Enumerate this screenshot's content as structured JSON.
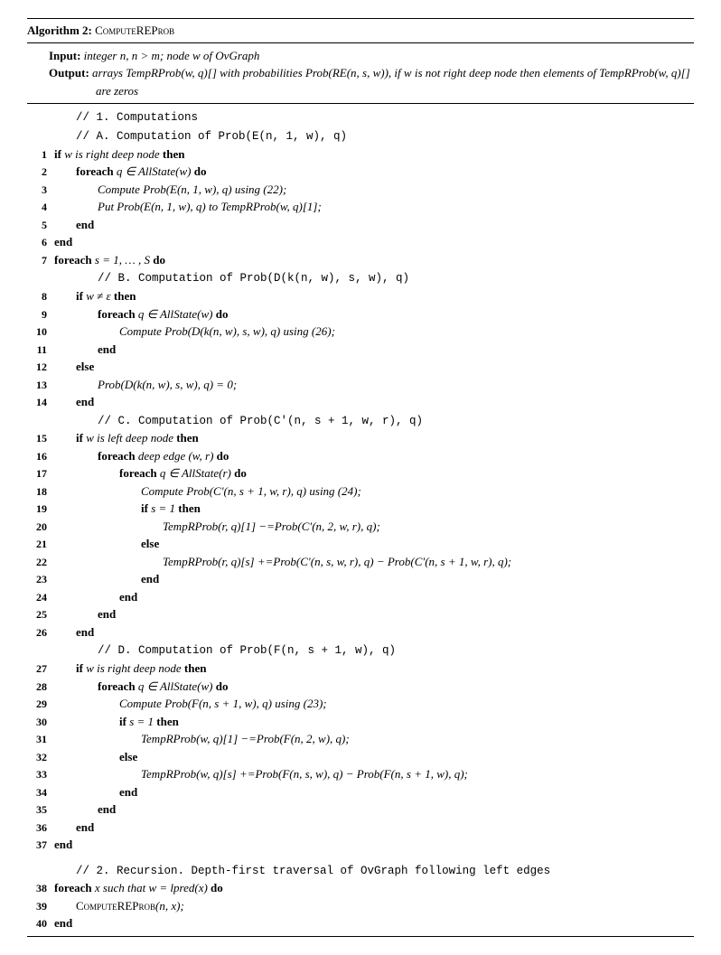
{
  "header": {
    "label": "Algorithm 2:",
    "name": "ComputeREProb"
  },
  "io": {
    "input_label": "Input:",
    "input_text": "integer n, n > m; node w of OvGraph",
    "output_label": "Output:",
    "output_text": "arrays TempRProb(w, q)[] with probabilities Prob(RE(n, s, w)), if w is not right deep node then elements of TempRProb(w, q)[] are zeros"
  },
  "comments": {
    "c1": "// 1. Computations",
    "cA": "// A. Computation of  Prob(E(n, 1, w), q)",
    "cB": "// B. Computation of  Prob(D(k(n, w), s, w), q)",
    "cC": "// C. Computation of  Prob(C′(n, s + 1, w, r), q)",
    "cD": "// D. Computation of  Prob(F(n, s + 1, w), q)",
    "c2": "// 2. Recursion. Depth-first traversal of OvGraph following left edges"
  },
  "lines": {
    "l1": {
      "kw1": "if",
      "cond": "w is right deep node",
      "kw2": "then"
    },
    "l2": {
      "kw1": "foreach",
      "expr": "q ∈ AllState(w)",
      "kw2": "do"
    },
    "l3": {
      "text": "Compute Prob(E(n, 1, w), q) using (22);"
    },
    "l4": {
      "text": "Put Prob(E(n, 1, w), q) to TempRProb(w, q)[1];"
    },
    "l5": {
      "kw": "end"
    },
    "l6": {
      "kw": "end"
    },
    "l7": {
      "kw1": "foreach",
      "expr": "s = 1, … , S",
      "kw2": "do"
    },
    "l8": {
      "kw1": "if",
      "cond": "w ≠ ε",
      "kw2": "then"
    },
    "l9": {
      "kw1": "foreach",
      "expr": "q ∈ AllState(w)",
      "kw2": "do"
    },
    "l10": {
      "text": "Compute Prob(D(k(n, w), s, w), q) using (26);"
    },
    "l11": {
      "kw": "end"
    },
    "l12": {
      "kw": "else"
    },
    "l13": {
      "text": "Prob(D(k(n, w), s, w), q) = 0;"
    },
    "l14": {
      "kw": "end"
    },
    "l15": {
      "kw1": "if",
      "cond": "w is left deep node",
      "kw2": "then"
    },
    "l16": {
      "kw1": "foreach",
      "expr": "deep edge (w, r)",
      "kw2": "do"
    },
    "l17": {
      "kw1": "foreach",
      "expr": "q ∈ AllState(r)",
      "kw2": "do"
    },
    "l18": {
      "text": "Compute Prob(C′(n, s + 1, w, r), q) using (24);"
    },
    "l19": {
      "kw1": "if",
      "cond": "s = 1",
      "kw2": "then"
    },
    "l20": {
      "text": "TempRProb(r, q)[1]  −=Prob(C′(n, 2, w, r), q);"
    },
    "l21": {
      "kw": "else"
    },
    "l22": {
      "text": "TempRProb(r, q)[s] +=Prob(C′(n, s, w, r), q) − Prob(C′(n, s + 1, w, r), q);"
    },
    "l23": {
      "kw": "end"
    },
    "l24": {
      "kw": "end"
    },
    "l25": {
      "kw": "end"
    },
    "l26": {
      "kw": "end"
    },
    "l27": {
      "kw1": "if",
      "cond": "w is right deep node",
      "kw2": "then"
    },
    "l28": {
      "kw1": "foreach",
      "expr": "q ∈ AllState(w)",
      "kw2": "do"
    },
    "l29": {
      "text": "Compute Prob(F(n, s + 1, w), q) using (23);"
    },
    "l30": {
      "kw1": "if",
      "cond": "s = 1",
      "kw2": "then"
    },
    "l31": {
      "text": "TempRProb(w, q)[1]  −=Prob(F(n, 2, w), q);"
    },
    "l32": {
      "kw": "else"
    },
    "l33": {
      "text": "TempRProb(w, q)[s] +=Prob(F(n, s, w), q) − Prob(F(n, s + 1, w), q);"
    },
    "l34": {
      "kw": "end"
    },
    "l35": {
      "kw": "end"
    },
    "l36": {
      "kw": "end"
    },
    "l37": {
      "kw": "end"
    },
    "l38": {
      "kw1": "foreach",
      "expr": "x such that w = lpred(x)",
      "kw2": "do"
    },
    "l39": {
      "name": "ComputeREProb",
      "args": "(n, x);"
    },
    "l40": {
      "kw": "end"
    }
  }
}
